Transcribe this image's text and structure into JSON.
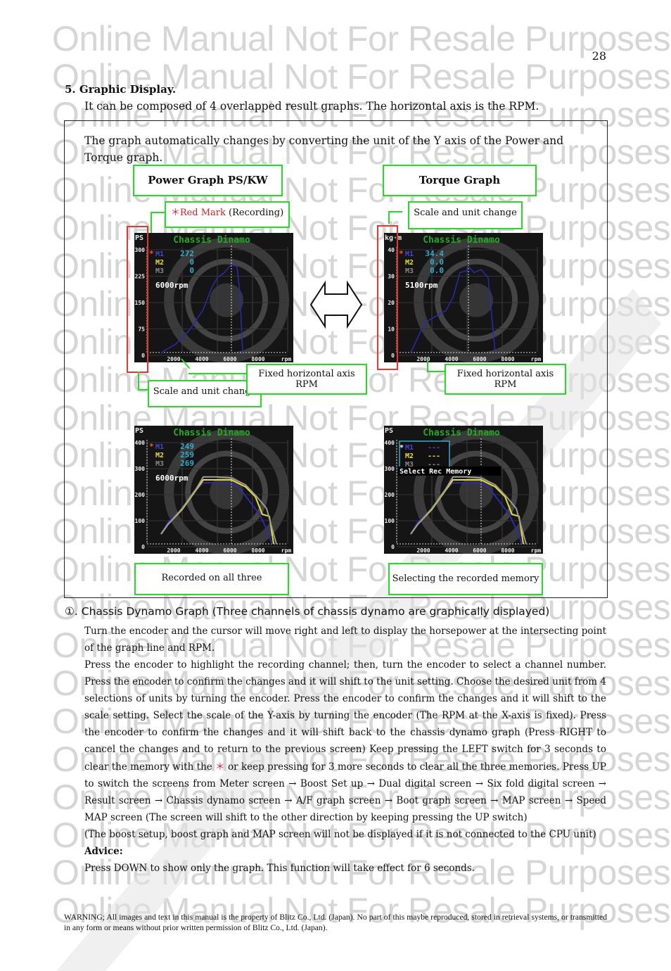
{
  "watermark": "Online Manual Not For Resale Purposes",
  "page_number": "28",
  "section": {
    "title": "5.  Graphic Display.",
    "description": "It can be composed of 4 overlapped result graphs. The horizontal axis is the RPM."
  },
  "figure": {
    "intro": "The graph automatically changes by converting the unit of the Y axis of the Power and Torque graph.",
    "power_title": "Power Graph PS/KW",
    "torque_title": "Torque Graph",
    "red_mark_star": "＊Red Mark",
    "red_mark_suffix": " (Recording)",
    "scale_unit_label": "Scale and unit change",
    "fixed_axis_label": "Fixed horizontal axis RPM",
    "recorded_all_label": "Recorded on all three",
    "selecting_label": "Selecting the recorded memory",
    "screens": [
      {
        "name": "power",
        "app_title": "Chassis Dinamo",
        "unit": "PS",
        "y_ticks": [
          "300",
          "225",
          "150",
          "75",
          "0"
        ],
        "x_ticks": [
          "2000",
          "4000",
          "6000",
          "8000",
          "rpm"
        ],
        "channels": [
          {
            "label": "M1",
            "value": "272",
            "color": "#3333cc",
            "recording": true
          },
          {
            "label": "M2",
            "value": "0",
            "color": "#e8e020"
          },
          {
            "label": "M3",
            "value": "0",
            "color": "#888888"
          }
        ],
        "rpm_readout": "6000rpm",
        "cursor_rpm": 6000
      },
      {
        "name": "torque",
        "app_title": "Chassis Dinamo",
        "unit": "kg·m",
        "y_ticks": [
          "40",
          "30",
          "20",
          "10",
          "0"
        ],
        "x_ticks": [
          "2000",
          "4000",
          "6000",
          "8000",
          "rpm"
        ],
        "channels": [
          {
            "label": "M1",
            "value": "34.4",
            "color": "#3333cc",
            "recording": true
          },
          {
            "label": "M2",
            "value": "0.0",
            "color": "#e8e020"
          },
          {
            "label": "M3",
            "value": "0.0",
            "color": "#888888"
          }
        ],
        "rpm_readout": "5100rpm",
        "cursor_rpm": 5100
      },
      {
        "name": "recorded-all",
        "app_title": "Chassis Dinamo",
        "unit": "PS",
        "y_ticks": [
          "400",
          "300",
          "200",
          "100",
          "0"
        ],
        "x_ticks": [
          "2000",
          "4000",
          "6000",
          "8000",
          "rpm"
        ],
        "channels": [
          {
            "label": "M1",
            "value": "249",
            "color": "#3333cc",
            "recording": true
          },
          {
            "label": "M2",
            "value": "259",
            "color": "#e8e020"
          },
          {
            "label": "M3",
            "value": "269",
            "color": "#888888"
          }
        ],
        "rpm_readout": "6000rpm",
        "cursor_rpm": 6000
      },
      {
        "name": "select-memory",
        "app_title": "Chassis Dinamo",
        "unit": "PS",
        "y_ticks": [
          "400",
          "300",
          "200",
          "100",
          "0"
        ],
        "x_ticks": [
          "2000",
          "4000",
          "6000",
          "8000",
          "rpm"
        ],
        "channels": [
          {
            "label": "M1",
            "value": "---",
            "color": "#3333cc",
            "recording": true
          },
          {
            "label": "M2",
            "value": "---",
            "color": "#e8e020"
          },
          {
            "label": "M3",
            "value": "---",
            "color": "#888888"
          }
        ],
        "menu_label": "Select Rec Memory",
        "cursor_rpm": 6000
      }
    ]
  },
  "item1": {
    "heading": "①. Chassis Dynamo Graph (Three channels of chassis dynamo are graphically displayed)",
    "paragraph1": "Turn the encoder and the cursor will move right and left to display the horsepower at the intersecting point of the graph line and RPM.",
    "paragraph2a": "Press the encoder to highlight the recording channel; then, turn the encoder to select a channel number. Press the encoder to confirm the changes and it will shift to the unit setting. Choose the desired unit from 4 selections of units by turning the encoder. Press the encoder to confirm the changes and it will shift to the scale setting. Select the scale of the Y-axis by turning the encoder (The RPM at the X-axis is fixed). Press the encoder to confirm the changes and it will shift back to the chassis dynamo graph (Press RIGHT to cancel the changes and to return to the previous screen) Keep pressing the LEFT switch for 3 seconds to clear the memory with the ",
    "star": "＊",
    "paragraph2b": " or keep pressing for 3 more seconds to clear all the three memories. Press UP to switch the screens from Meter screen → Boost Set up → Dual digital screen → Six fold digital screen → Result screen → Chassis dynamo screen → A/F graph screen → Boot graph screen → MAP screen → Speed MAP screen (The screen will shift to the other direction by keeping pressing the UP switch)",
    "paragraph3": "(The boost setup, boost graph and MAP screen will not be displayed if it is not connected to the CPU unit)",
    "advice_label": "Advice:",
    "advice_text": "Press DOWN to show only the graph. This function will take effect for 6 seconds."
  },
  "warning": "WARNING; All images and text in this manual is the property of Blitz Co., Ltd. (Japan). No part of this maybe reproduced, stored in retrieval systems, or transmitted in any form or means without prior written permission of Blitz Co., Ltd. (Japan)."
}
